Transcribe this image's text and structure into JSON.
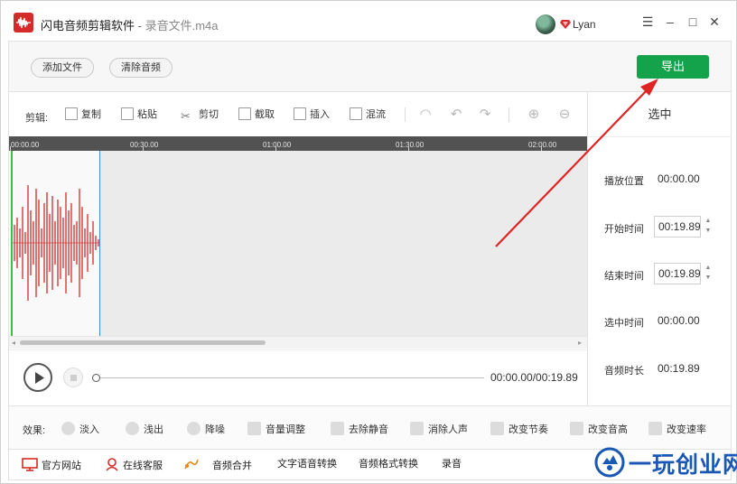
{
  "titlebar": {
    "app_name": "闪电音频剪辑软件",
    "separator": " - ",
    "file_name": "录音文件.m4a",
    "username": "Lyan",
    "minimize": "–",
    "maximize": "□",
    "close": "✕",
    "menu": "☰"
  },
  "toolbar": {
    "add_file": "添加文件",
    "clear_audio": "清除音频",
    "export": "导出"
  },
  "edit_toolbar": {
    "label": "剪辑:",
    "copy": "复制",
    "paste": "粘贴",
    "cut": "剪切",
    "crop": "截取",
    "insert": "插入",
    "mix": "混流"
  },
  "timeline": {
    "ticks": [
      "00:00.00",
      "00:30.00",
      "01:00.00",
      "01:30.00",
      "02:00.00"
    ]
  },
  "player": {
    "time_readout": "00:00.00/00:19.89"
  },
  "side_panel": {
    "title": "选中",
    "play_position_label": "播放位置",
    "play_position_value": "00:00.00",
    "start_time_label": "开始时间",
    "start_time_value": "00:19.89",
    "end_time_label": "结束时间",
    "end_time_value": "00:19.89",
    "selected_time_label": "选中时间",
    "selected_time_value": "00:00.00",
    "duration_label": "音频时长",
    "duration_value": "00:19.89"
  },
  "effects": {
    "label": "效果:",
    "fade_in": "淡入",
    "fade_out": "浅出",
    "denoise": "降噪",
    "volume": "音量调整",
    "remove_silence": "去除静音",
    "remove_vocals": "消除人声",
    "change_tempo": "改变节奏",
    "change_pitch": "改变音高",
    "change_speed": "改变速率"
  },
  "bottombar": {
    "official_site": "官方网站",
    "online_support": "在线客服",
    "audio_merge": "音频合并",
    "tts": "文字语音转换",
    "format_convert": "音频格式转换",
    "record": "录音"
  },
  "watermark": {
    "text": "一玩创业网"
  },
  "colors": {
    "brand_red": "#d62a2a",
    "export_green": "#14a24b",
    "waveform_red": "#d23a3a",
    "watermark_blue": "#1b58b4",
    "annotation_red": "#e02424"
  },
  "icons": {
    "app": "waveform-logo-icon",
    "vip": "diamond-icon",
    "official_site": "monitor-icon",
    "online_support": "person-icon",
    "audio_merge": "merge-icon"
  }
}
